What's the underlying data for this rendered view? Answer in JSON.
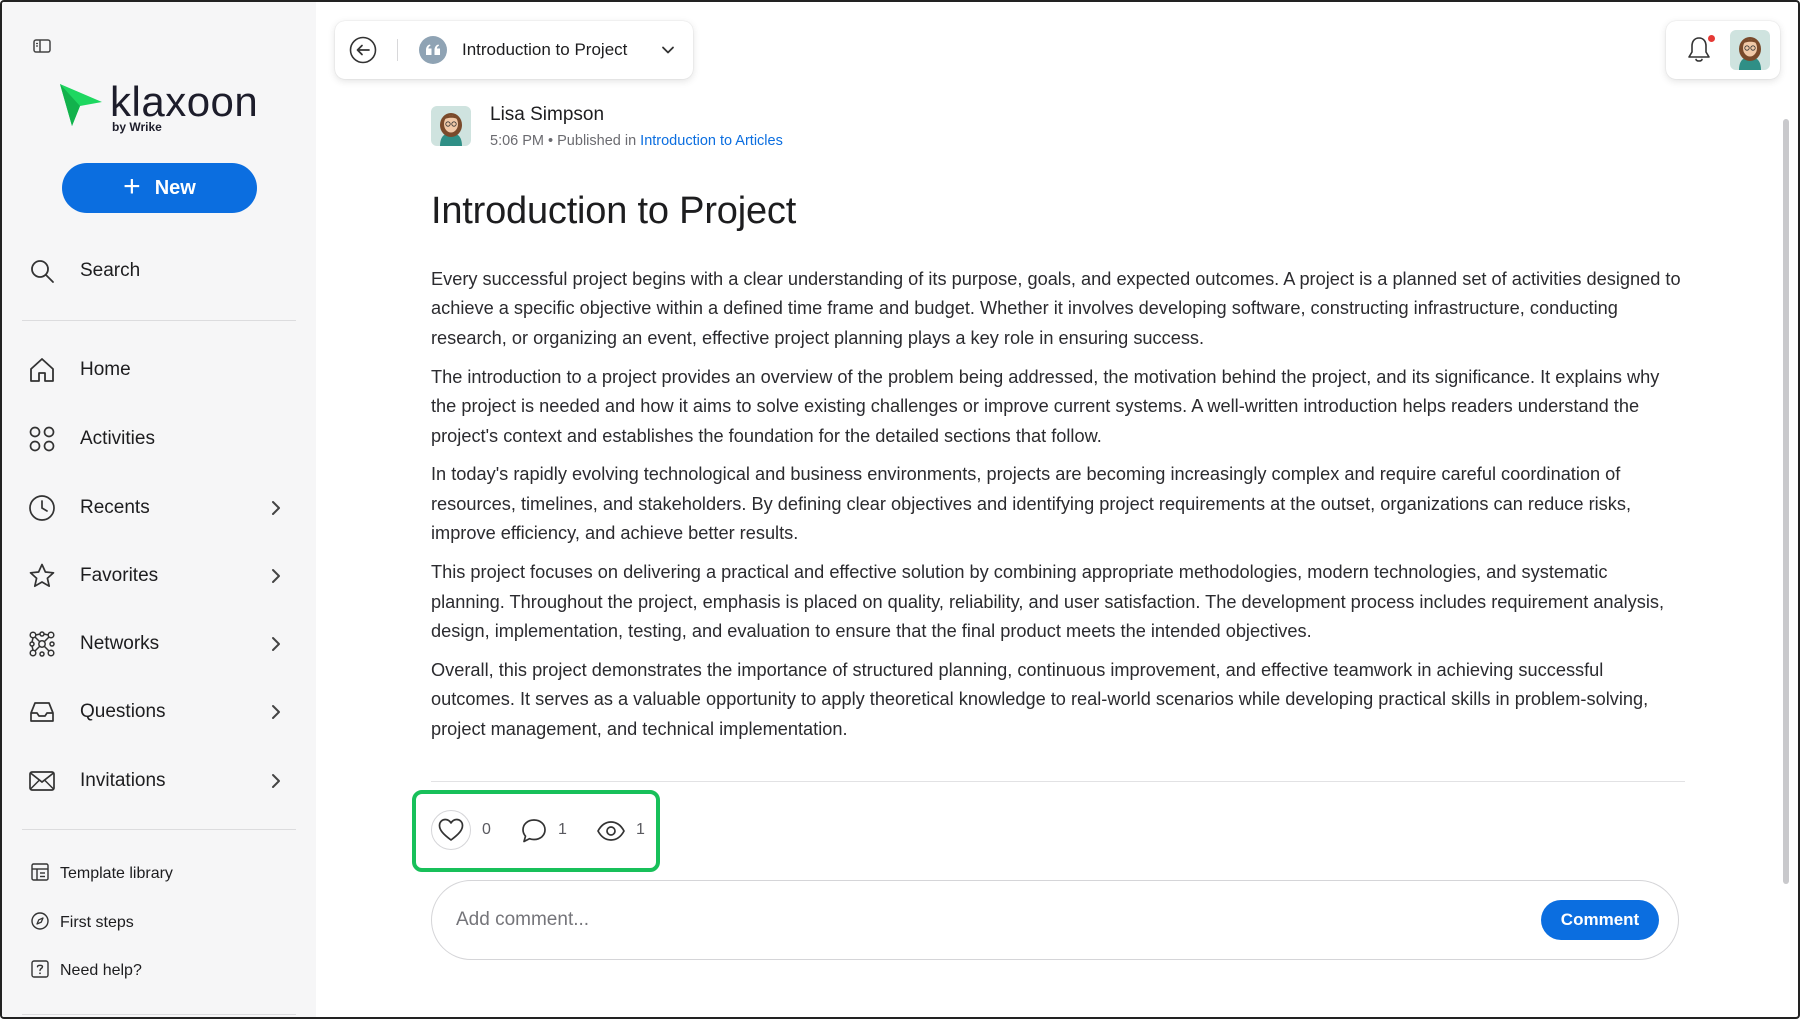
{
  "sidebar": {
    "brand": {
      "name": "klaxoon",
      "sub": "by Wrike",
      "accent": "#1ed760"
    },
    "new_label": "New",
    "search_label": "Search",
    "items": [
      {
        "label": "Home",
        "icon": "home-icon",
        "has_chevron": false
      },
      {
        "label": "Activities",
        "icon": "activities-icon",
        "has_chevron": false
      },
      {
        "label": "Recents",
        "icon": "clock-icon",
        "has_chevron": true
      },
      {
        "label": "Favorites",
        "icon": "star-icon",
        "has_chevron": true
      },
      {
        "label": "Networks",
        "icon": "network-icon",
        "has_chevron": true
      },
      {
        "label": "Questions",
        "icon": "inbox-icon",
        "has_chevron": true
      },
      {
        "label": "Invitations",
        "icon": "envelope-icon",
        "has_chevron": true
      }
    ],
    "footer": [
      {
        "label": "Template library",
        "icon": "template-icon"
      },
      {
        "label": "First steps",
        "icon": "compass-icon"
      },
      {
        "label": "Need help?",
        "icon": "help-icon"
      }
    ]
  },
  "header": {
    "breadcrumb_title": "Introduction to Project"
  },
  "article": {
    "author": "Lisa Simpson",
    "time": "5:06 PM",
    "published_prefix": "Published in",
    "published_in": "Introduction to Articles",
    "title": "Introduction to Project",
    "paragraphs": [
      "Every successful project begins with a clear understanding of its purpose, goals, and expected outcomes. A project is a planned set of activities designed to achieve a specific objective within a defined time frame and budget. Whether it involves developing software, constructing infrastructure, conducting research, or organizing an event, effective project planning plays a key role in ensuring success.",
      "The introduction to a project provides an overview of the problem being addressed, the motivation behind the project, and its significance. It explains why the project is needed and how it aims to solve existing challenges or improve current systems. A well-written introduction helps readers understand the project's context and establishes the foundation for the detailed sections that follow.",
      "In today's rapidly evolving technological and business environments, projects are becoming increasingly complex and require careful coordination of resources, timelines, and stakeholders. By defining clear objectives and identifying project requirements at the outset, organizations can reduce risks, improve efficiency, and achieve better results.",
      "This project focuses on delivering a practical and effective solution by combining appropriate methodologies, modern technologies, and systematic planning. Throughout the project, emphasis is placed on quality, reliability, and user satisfaction. The development process includes requirement analysis, design, implementation, testing, and evaluation to ensure that the final product meets the intended objectives.",
      "Overall, this project demonstrates the importance of structured planning, continuous improvement, and effective teamwork in achieving successful outcomes. It serves as a valuable opportunity to apply theoretical knowledge to real-world scenarios while developing practical skills in problem-solving, project management, and technical implementation."
    ]
  },
  "reactions": {
    "likes": "0",
    "comments": "1",
    "views": "1"
  },
  "comment": {
    "placeholder": "Add comment...",
    "button_label": "Comment"
  },
  "colors": {
    "primary": "#0b6ee0",
    "highlight": "#18c05a",
    "notification_dot": "#e53935"
  }
}
